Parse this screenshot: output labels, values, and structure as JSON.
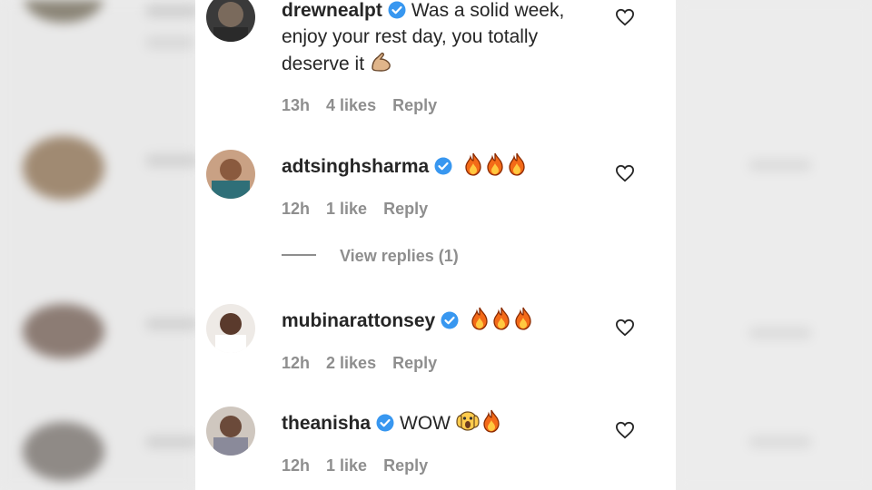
{
  "comments": [
    {
      "username": "drewnealpt",
      "verified": true,
      "text_line1": "Was a solid week,",
      "text_line2": "enjoy your rest day, you totally",
      "text_line3": "deserve it",
      "emoji": "flexed-biceps",
      "age": "13h",
      "likes": "4 likes",
      "reply_label": "Reply"
    },
    {
      "username": "adtsinghsharma",
      "verified": true,
      "emoji": "fire x3",
      "age": "12h",
      "likes": "1 like",
      "reply_label": "Reply",
      "view_replies": "View replies (1)"
    },
    {
      "username": "mubinarattonsey",
      "verified": true,
      "emoji": "fire x3",
      "age": "12h",
      "likes": "2 likes",
      "reply_label": "Reply"
    },
    {
      "username": "theanisha",
      "verified": true,
      "text": "WOW",
      "emoji": "screaming-face + fire",
      "age": "12h",
      "likes": "1 like",
      "reply_label": "Reply"
    }
  ],
  "colors": {
    "text": "#262626",
    "muted": "#8e8e8e",
    "verified_blue": "#3897f0",
    "background": "#ececec"
  }
}
